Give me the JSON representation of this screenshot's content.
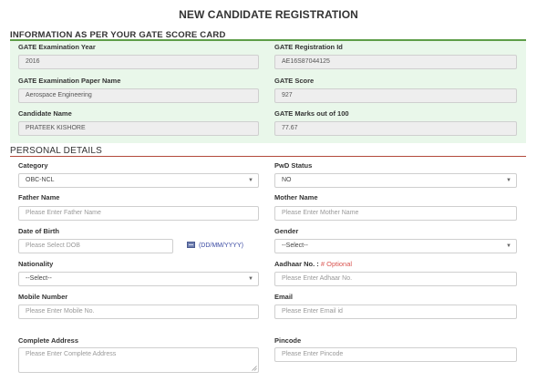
{
  "page": {
    "title": "NEW CANDIDATE REGISTRATION"
  },
  "gate_section": {
    "heading": "INFORMATION AS PER YOUR GATE SCORE CARD",
    "fields": {
      "exam_year": {
        "label": "GATE Examination Year",
        "value": "2016"
      },
      "reg_id": {
        "label": "GATE Registration Id",
        "value": "AE16S87044125"
      },
      "paper_name": {
        "label": "GATE Examination Paper Name",
        "value": "Aerospace Engineering"
      },
      "score": {
        "label": "GATE Score",
        "value": "927"
      },
      "candidate_name": {
        "label": "Candidate Name",
        "value": "PRATEEK KISHORE"
      },
      "marks": {
        "label": "GATE Marks out of 100",
        "value": "77.67"
      }
    }
  },
  "personal_section": {
    "heading": "PERSONAL DETAILS",
    "category": {
      "label": "Category",
      "selected": "OBC-NCL"
    },
    "pwd_status": {
      "label": "PwD Status",
      "selected": "NO"
    },
    "father_name": {
      "label": "Father Name",
      "placeholder": "Please Enter Father Name"
    },
    "mother_name": {
      "label": "Mother Name",
      "placeholder": "Please Enter Mother Name"
    },
    "dob": {
      "label": "Date of Birth",
      "placeholder": "Please Select DOB",
      "format_hint": "(DD/MM/YYYY)",
      "icon": "calendar-icon"
    },
    "gender": {
      "label": "Gender",
      "selected": "--Select--"
    },
    "nationality": {
      "label": "Nationality",
      "selected": "--Select--"
    },
    "aadhaar": {
      "label": "Aadhaar No. :",
      "optional_mark": "# Optional",
      "placeholder": "Please Enter Adhaar No."
    },
    "mobile": {
      "label": "Mobile Number",
      "placeholder": "Please Enter Mobile No."
    },
    "email": {
      "label": "Email",
      "placeholder": "Please Enter Email id"
    },
    "address": {
      "label": "Complete Address",
      "placeholder": "Please Enter Complete Address"
    },
    "pincode": {
      "label": "Pincode",
      "placeholder": "Please Enter Pincode"
    }
  },
  "colors": {
    "panel_bg": "#e9f7ea",
    "gate_rule": "#5e9e48",
    "personal_rule": "#b34a3c",
    "hint": "#3a4aa3",
    "optional": "#d9534f"
  }
}
